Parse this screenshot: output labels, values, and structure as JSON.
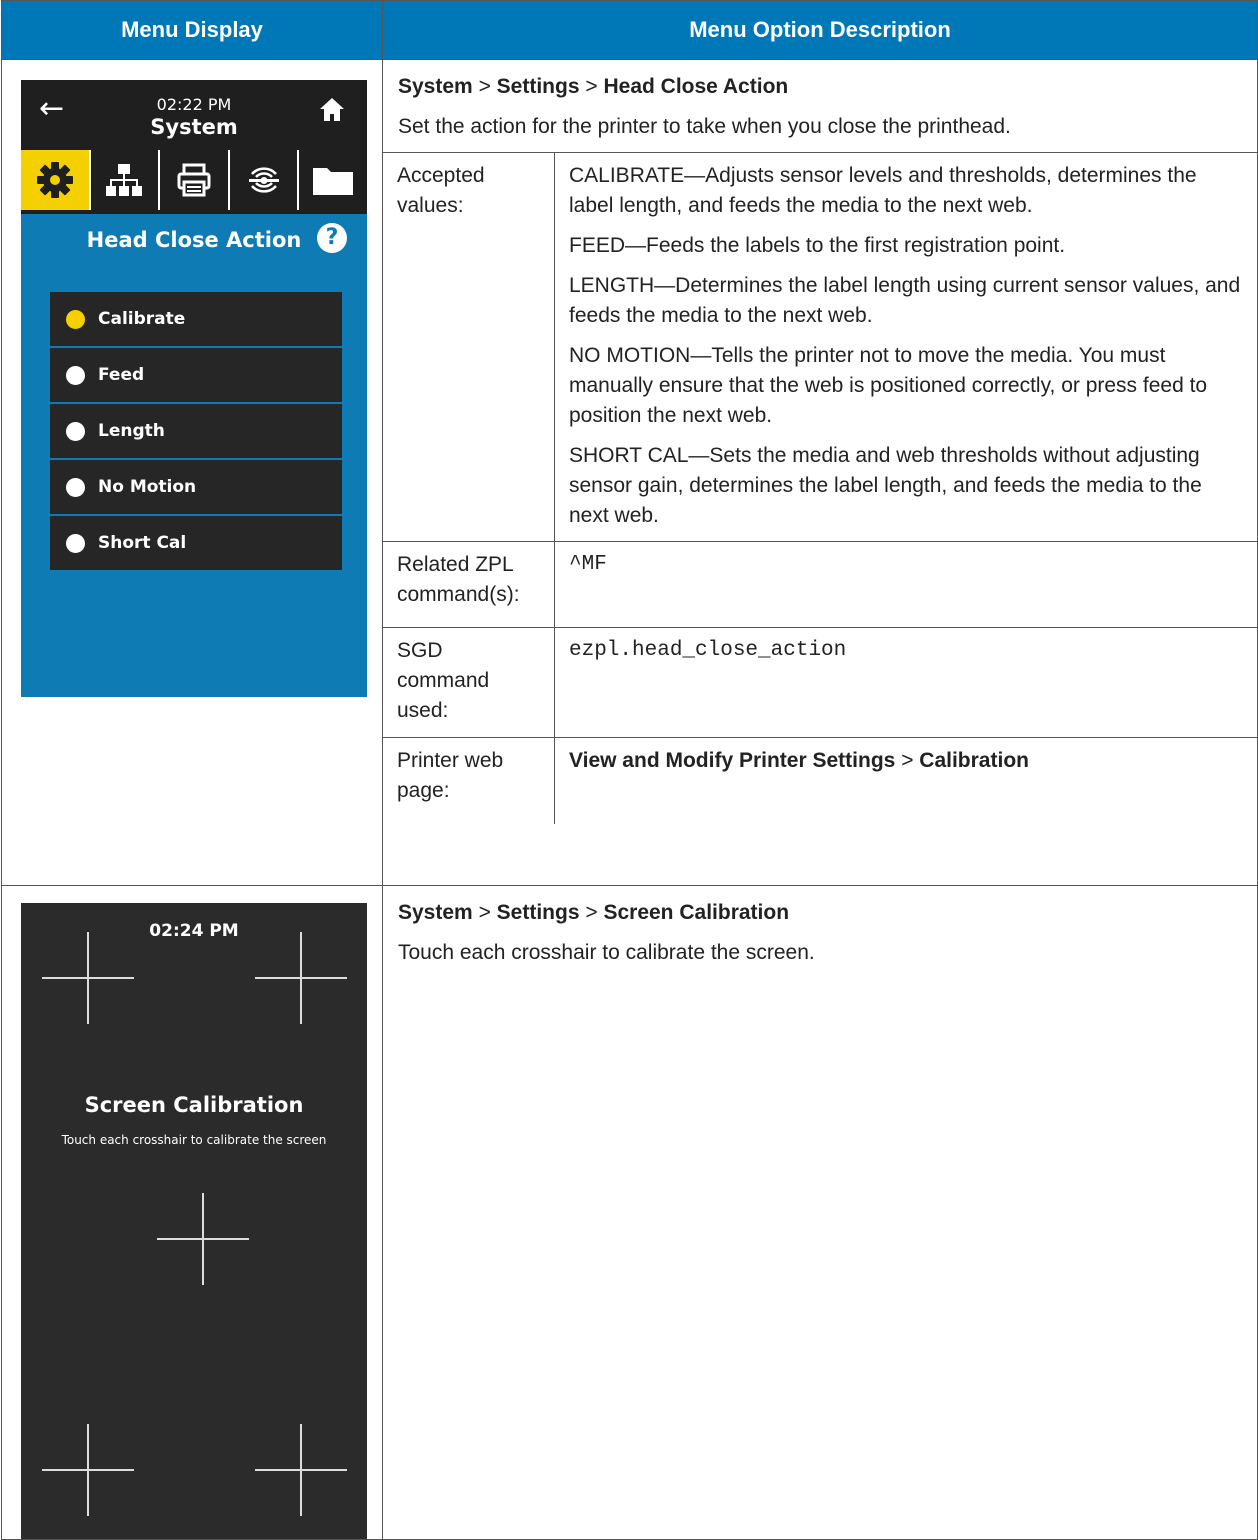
{
  "header": {
    "col1": "Menu Display",
    "col2": "Menu Option Description"
  },
  "row1": {
    "screen": {
      "time": "02:22 PM",
      "title": "System",
      "heading": "Head Close Action",
      "help": "?",
      "options": [
        "Calibrate",
        "Feed",
        "Length",
        "No Motion",
        "Short Cal"
      ],
      "selected": "Calibrate",
      "accent_color": "#f5d000",
      "bg_color": "#0e7bb4"
    },
    "path": {
      "p1": "System",
      "sep1": ">",
      "p2": "Settings",
      "sep2": ">",
      "p3": "Head Close Action"
    },
    "intro": "Set the action for the printer to take when you close the printhead.",
    "accepted_label": "Accepted values:",
    "accepted": [
      "CALIBRATE—Adjusts sensor levels and thresholds, determines the label length, and feeds the media to the next web.",
      "FEED—Feeds the labels to the first registration point.",
      "LENGTH—Determines the label length using current sensor values, and feeds the media to the next web.",
      "NO MOTION—Tells the printer not to move the media. You must manually ensure that the web is positioned correctly, or press feed to position the next web.",
      "SHORT CAL—Sets the media and web thresholds without adjusting sensor gain, determines the label length, and feeds the media to the next web."
    ],
    "zpl_label": "Related ZPL command(s):",
    "zpl_value": "^MF",
    "sgd_label": "SGD command used:",
    "sgd_value": "ezpl.head_close_action",
    "web_label": "Printer web page:",
    "web": {
      "w1": "View and Modify Printer Settings",
      "sep": ">",
      "w2": "Calibration"
    }
  },
  "row2": {
    "screen": {
      "time": "02:24 PM",
      "title": "Screen Calibration",
      "subtitle": "Touch each crosshair to calibrate the screen"
    },
    "path": {
      "p1": "System",
      "sep1": ">",
      "p2": "Settings",
      "sep2": ">",
      "p3": "Screen Calibration"
    },
    "intro": "Touch each crosshair to calibrate the screen."
  }
}
